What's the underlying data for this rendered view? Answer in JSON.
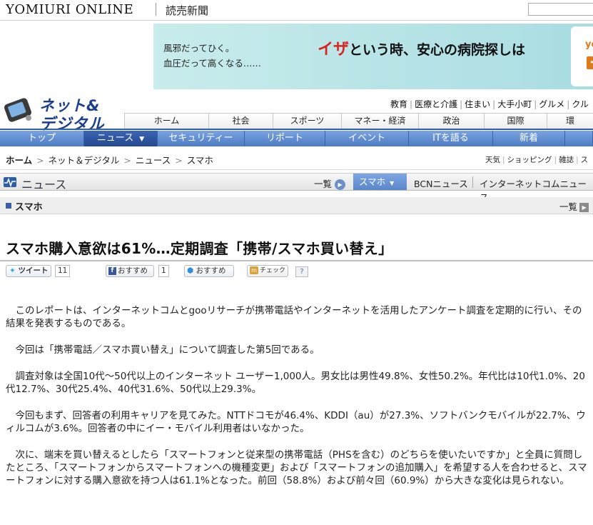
{
  "brand": {
    "name_en": "YOMIURI ONLINE",
    "name_ja": "読売新聞"
  },
  "ad": {
    "line1": "風邪だってひく。",
    "line2": "血圧だって高くなる……",
    "headline_accent": "イザ",
    "headline_rest": "という時、安心の病院探しは",
    "box_text": "yom"
  },
  "section": {
    "logo_line1": "ネット",
    "logo_amp": "&",
    "logo_line2": "デジタル"
  },
  "portal_links": [
    "教育",
    "医療と介護",
    "住まい",
    "大手小町",
    "グルメ",
    "クル"
  ],
  "global_nav": [
    "ホーム",
    "社会",
    "スポーツ",
    "マネー・経済",
    "政治",
    "国際",
    "環"
  ],
  "section_nav": [
    {
      "label": "トップ",
      "active": false
    },
    {
      "label": "ニュース",
      "active": true,
      "arrow": "▼"
    },
    {
      "label": "セキュリティー",
      "active": false
    },
    {
      "label": "リポート",
      "active": false
    },
    {
      "label": "イベント",
      "active": false
    },
    {
      "label": "ITを語る",
      "active": false
    },
    {
      "label": "新着",
      "active": false
    }
  ],
  "breadcrumb": [
    "ホーム",
    "ネット＆デジタル",
    "ニュース",
    "スマホ"
  ],
  "breadcrumb_sep": ">",
  "utility_links": [
    "天気",
    "ショッピング",
    "雑誌",
    "ス"
  ],
  "news_bar": {
    "title": "ニュース",
    "list_label": "一覧",
    "list_arrow": "▶",
    "active_tab": "スマホ",
    "active_tab_arrow": "▼",
    "tab2": "BCNニュース",
    "tab3": "インターネットコムニュース"
  },
  "subhead": {
    "title": "スマホ",
    "list_label": "一覧",
    "list_arrow": "▶"
  },
  "article": {
    "headline": "スマホ購入意欲は61%…定期調査「携帯/スマホ買い替え」",
    "paragraphs": [
      "このレポートは、インターネットコムとgooリサーチが携帯電話やインターネットを活用したアンケート調査を定期的に行い、その結果を発表するものである。",
      "今回は「携帯電話／スマホ買い替え」について調査した第5回である。",
      "調査対象は全国10代～50代以上のインターネット ユーザー1,000人。男女比は男性49.8%、女性50.2%。年代比は10代1.0%、20代12.7%、30代25.4%、40代31.6%、50代以上29.3%。",
      "今回もまず、回答者の利用キャリアを見てみた。NTTドコモが46.4%、KDDI（au）が27.3%、ソフトバンクモバイルが22.7%、ウィルコムが3.6%。回答者の中にイー・モバイル利用者はいなかった。",
      "次に、端末を買い替えるとしたら「スマートフォンと従来型の携帯電話（PHSを含む）のどちらを使いたいですか」と全員に質問したところ、「スマートフォンからスマートフォンへの機種変更」および「スマートフォンの追加購入」を希望する人を合わせると、スマートフォンに対する購入意欲を持つ人は61.1%となった。前回（58.8%）および前々回（60.9%）から大きな変化は見られない。"
    ]
  },
  "social": {
    "tweet_label": "ツイート",
    "tweet_count": "11",
    "fb_label": "おすすめ",
    "fb_count": "1",
    "hex_label": "おすすめ",
    "check_label": "チェック",
    "help_label": "?"
  },
  "colors": {
    "nav_blue": "#5a86c9",
    "nav_active": "#24498f",
    "logo_blue": "#1b3f8a",
    "ad_red": "#d8231f"
  }
}
